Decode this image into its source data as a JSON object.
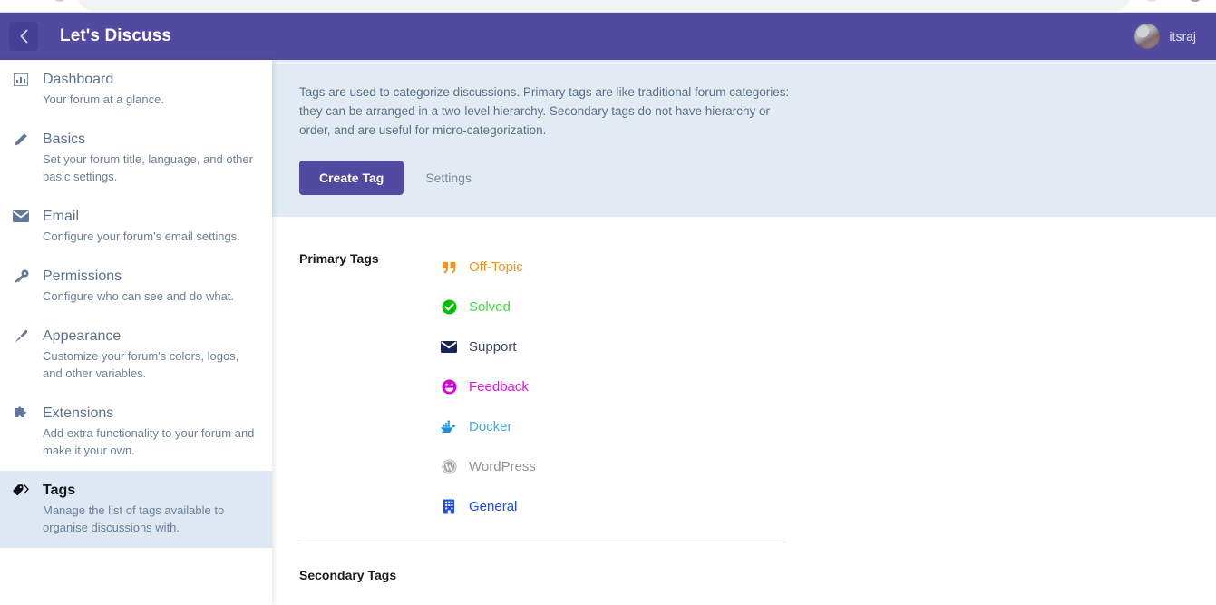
{
  "browser": {
    "back_icon": "back-arrow-icon",
    "forward_icon": "forward-arrow-icon",
    "reload_icon": "reload-icon",
    "bookmark_icon": "star-icon",
    "profile_icon": "profile-icon"
  },
  "header": {
    "back_label": "back-chevron",
    "title": "Let's Discuss",
    "user_name": "itsraj",
    "bg_color": "#514aa0"
  },
  "sidebar": {
    "items": [
      {
        "icon": "chart-bar-icon",
        "label": "Dashboard",
        "desc": "Your forum at a glance.",
        "active": false
      },
      {
        "icon": "pencil-icon",
        "label": "Basics",
        "desc": "Set your forum title, language, and other basic settings.",
        "active": false
      },
      {
        "icon": "envelope-icon",
        "label": "Email",
        "desc": "Configure your forum's email settings.",
        "active": false
      },
      {
        "icon": "key-icon",
        "label": "Permissions",
        "desc": "Configure who can see and do what.",
        "active": false
      },
      {
        "icon": "paintbrush-icon",
        "label": "Appearance",
        "desc": "Customize your forum's colors, logos, and other variables.",
        "active": false
      },
      {
        "icon": "puzzle-piece-icon",
        "label": "Extensions",
        "desc": "Add extra functionality to your forum and make it your own.",
        "active": false
      },
      {
        "icon": "tag-icon",
        "label": "Tags",
        "desc": "Manage the list of tags available to organise discussions with.",
        "active": true
      }
    ],
    "active_bg": "#dde8f2"
  },
  "hero": {
    "description": "Tags are used to categorize discussions. Primary tags are like traditional forum categories: they can be arranged in a two-level hierarchy. Secondary tags do not have hierarchy or order, and are useful for micro-categorization.",
    "create_label": "Create Tag",
    "settings_label": "Settings",
    "bg_color": "#e2ebf3"
  },
  "primary": {
    "title": "Primary Tags",
    "tags": [
      {
        "name": "Off-Topic",
        "color": "#f7941d",
        "icon": "quote-left-icon"
      },
      {
        "name": "Solved",
        "color": "#3ae03a",
        "icon": "check-circle-icon",
        "icon_color": "#00c000"
      },
      {
        "name": "Support",
        "color": "#3b4a6b",
        "icon": "envelope-solid-icon",
        "icon_color": "#17255c"
      },
      {
        "name": "Feedback",
        "color": "#e813e8",
        "icon": "smile-icon",
        "icon_color": "#d900d9"
      },
      {
        "name": "Docker",
        "color": "#4aa8e8",
        "icon": "docker-whale-icon",
        "icon_color": "#1d91e0"
      },
      {
        "name": "WordPress",
        "color": "#8c9299",
        "icon": "wordpress-icon",
        "icon_color": "#8c9299"
      },
      {
        "name": "General",
        "color": "#1f49f5",
        "icon": "building-icon",
        "icon_color": "#1f49f5"
      }
    ]
  },
  "secondary": {
    "title": "Secondary Tags",
    "tags": []
  }
}
